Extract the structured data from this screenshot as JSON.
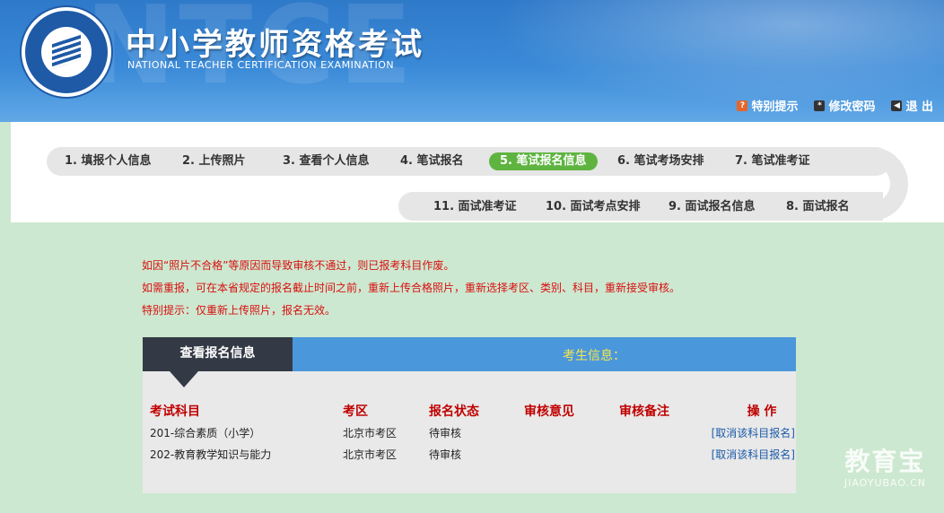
{
  "header": {
    "title_cn": "中小学教师资格考试",
    "title_en": "NATIONAL TEACHER CERTIFICATION EXAMINATION",
    "watermark": "NTCE",
    "nav": [
      {
        "label": "特别提示",
        "icon": "question-icon"
      },
      {
        "label": "修改密码",
        "icon": "password-icon"
      },
      {
        "label": "退 出",
        "icon": "logout-icon"
      }
    ]
  },
  "steps": {
    "row1": [
      "1. 填报个人信息",
      "2. 上传照片",
      "3. 查看个人信息",
      "4. 笔试报名",
      "5. 笔试报名信息",
      "6. 笔试考场安排",
      "7. 笔试准考证"
    ],
    "row2": [
      "11. 面试准考证",
      "10. 面试考点安排",
      "9. 面试报名信息",
      "8. 面试报名"
    ],
    "active": "5. 笔试报名信息"
  },
  "notice": {
    "lines": [
      "如因“照片不合格”等原因而导致审核不通过，则已报考科目作废。",
      "如需重报，可在本省规定的报名截止时间之前，重新上传合格照片，重新选择考区、类别、科目，重新接受审核。",
      "特别提示：仅重新上传照片，报名无效。"
    ]
  },
  "panel": {
    "tab": "查看报名信息",
    "title": "考生信息：",
    "columns": [
      "考试科目",
      "考区",
      "报名状态",
      "审核意见",
      "审核备注",
      "操 作"
    ],
    "rows": [
      {
        "subject": "201-综合素质（小学）",
        "area": "北京市考区",
        "status": "待审核",
        "opinion": "",
        "remark": "",
        "action": "[取消该科目报名]"
      },
      {
        "subject": "202-教育教学知识与能力",
        "area": "北京市考区",
        "status": "待审核",
        "opinion": "",
        "remark": "",
        "action": "[取消该科目报名]"
      }
    ]
  },
  "brand": {
    "cn": "教育宝",
    "en": "JIAOYUBAO.CN"
  },
  "colors": {
    "accent_green": "#5fb441",
    "header_blue": "#3a8ad8",
    "notice_red": "#d80f0f",
    "link_blue": "#1a5aa8"
  }
}
